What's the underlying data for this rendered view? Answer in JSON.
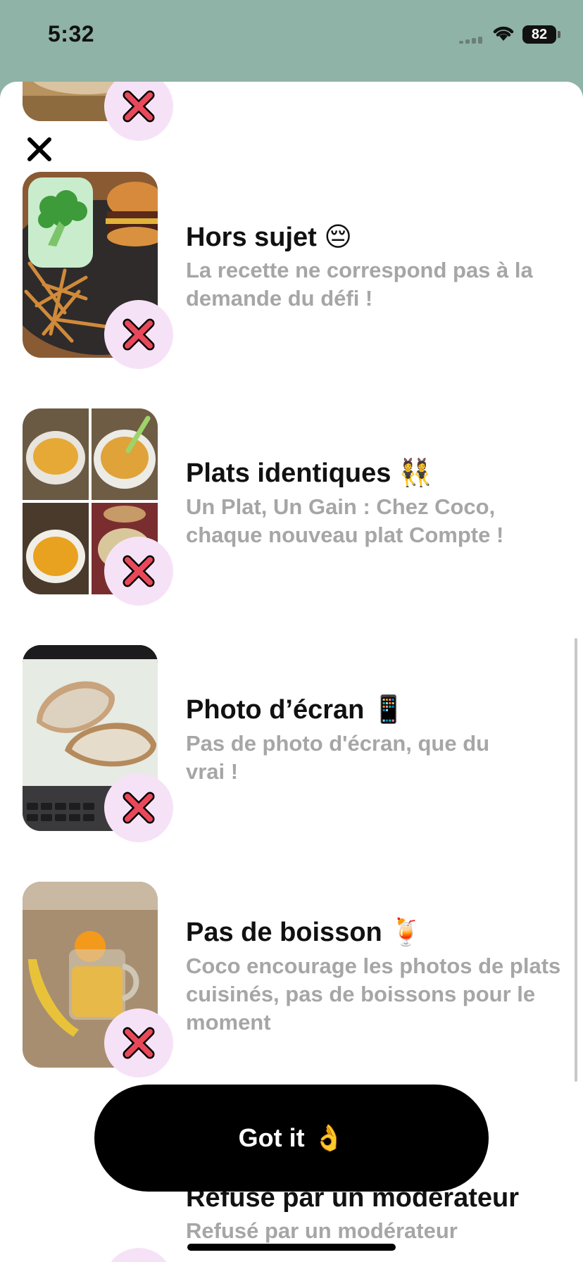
{
  "status_bar": {
    "time": "5:32",
    "battery": "82"
  },
  "items": [
    {
      "title": "Hors sujet",
      "emoji": "😔",
      "description": "La recette ne correspond pas à la demande du défi !"
    },
    {
      "title": "Plats identiques",
      "emoji": "👯",
      "description": "Un Plat, Un Gain : Chez Coco, chaque nouveau plat Compte !"
    },
    {
      "title": "Photo d’écran",
      "emoji": "📱",
      "description": "Pas de photo d'écran, que du vrai !"
    },
    {
      "title": "Pas de boisson",
      "emoji": "🍹",
      "description": "Coco encourage les photos de plats cuisinés, pas de boissons pour le moment"
    },
    {
      "title": "Refusé par un modérateur",
      "emoji": "",
      "description": "Refusé par un modérateur"
    }
  ],
  "cta": {
    "label": "Got it",
    "emoji": "👌"
  },
  "colors": {
    "header_bg": "#8fb3a6",
    "badge_bg": "#f6e2f7",
    "cross_red": "#e8485a",
    "cta_bg": "#000000"
  }
}
